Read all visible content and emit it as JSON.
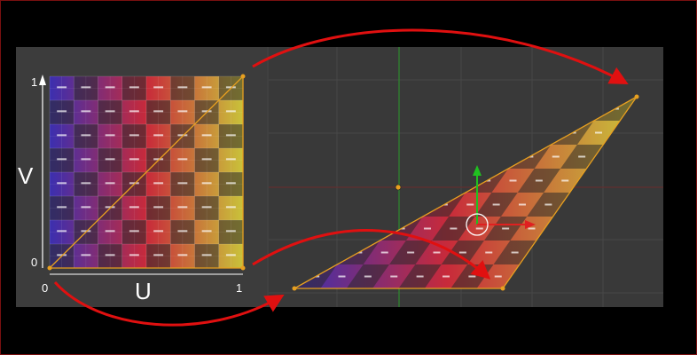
{
  "uv_editor": {
    "axis_u_label": "U",
    "axis_v_label": "V",
    "u_min_label": "0",
    "u_max_label": "1",
    "v_min_label": "0",
    "v_max_label": "1"
  },
  "texture": {
    "grid_rows": 8,
    "grid_cols": 8,
    "color_left": "#3b2fb0",
    "color_mid": "#c82a3a",
    "color_right": "#c9c23a",
    "checker_dark": "#2a2a2a"
  },
  "colors": {
    "arrow": "#e01010",
    "panel_bg": "#3a3a3a",
    "outline": "#e8a020",
    "gizmo_y": "#20c020",
    "gizmo_x": "#e02020",
    "green_axis": "#2a9a2a"
  }
}
